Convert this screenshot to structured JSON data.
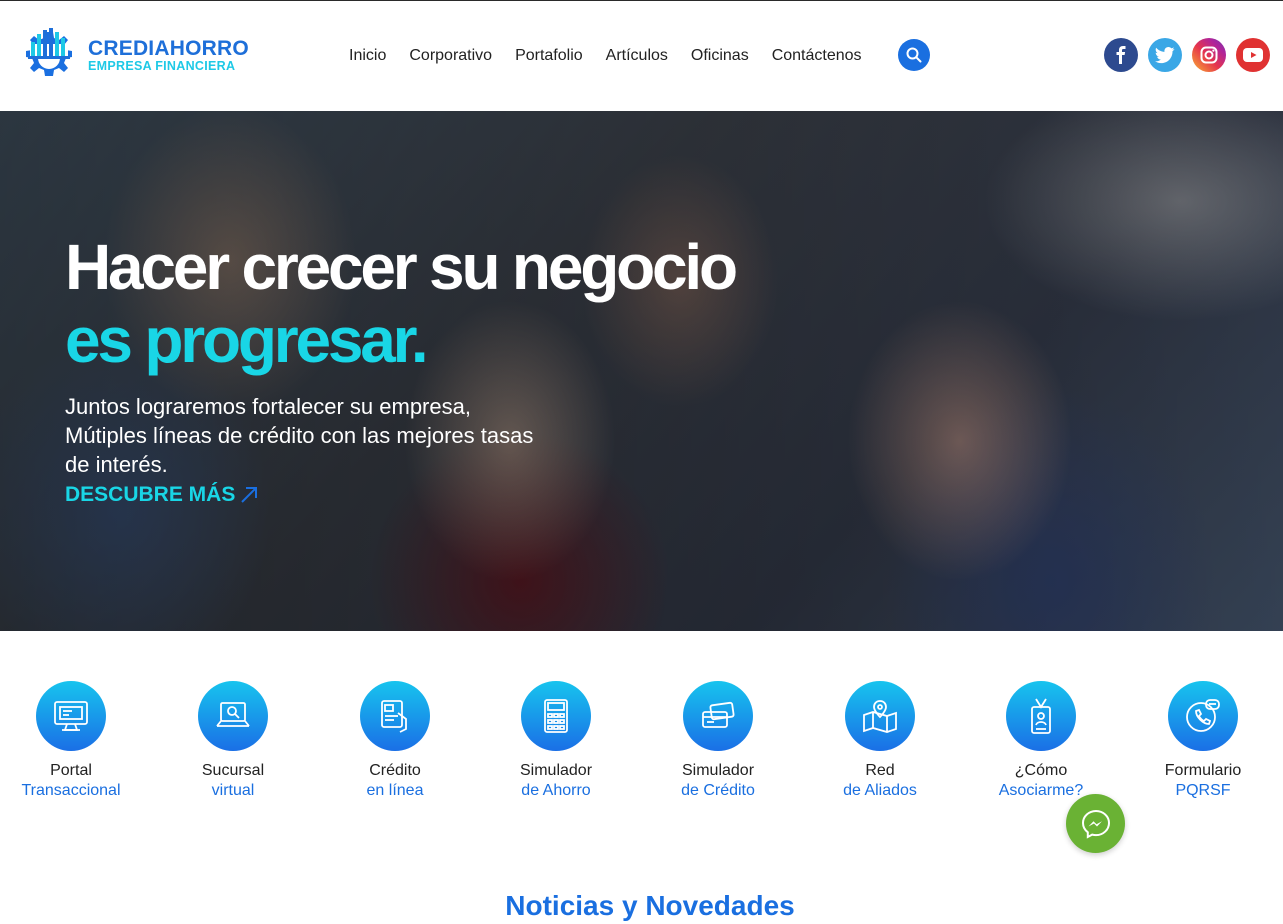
{
  "brand": {
    "name": "CREDIAHORRO",
    "tagline": "EMPRESA FINANCIERA",
    "colors": {
      "primary": "#1a6fe0",
      "accent": "#19d6e6"
    }
  },
  "nav": {
    "items": [
      "Inicio",
      "Corporativo",
      "Portafolio",
      "Artículos",
      "Oficinas",
      "Contáctenos"
    ]
  },
  "search": {
    "icon": "search-icon"
  },
  "social": [
    {
      "name": "facebook",
      "icon": "facebook-icon"
    },
    {
      "name": "twitter",
      "icon": "twitter-icon"
    },
    {
      "name": "instagram",
      "icon": "instagram-icon"
    },
    {
      "name": "youtube",
      "icon": "youtube-icon"
    }
  ],
  "hero": {
    "title_line1": "Hacer crecer su negocio",
    "title_line2": "es progresar.",
    "text": "Juntos lograremos fortalecer su empresa, Mútiples líneas de crédito con las mejores tasas de interés.",
    "cta": "DESCUBRE MÁS"
  },
  "services": [
    {
      "l1": "Portal",
      "l2": "Transaccional",
      "icon": "monitor-icon"
    },
    {
      "l1": "Sucursal",
      "l2": "virtual",
      "icon": "laptop-search-icon"
    },
    {
      "l1": "Crédito",
      "l2": "en línea",
      "icon": "hand-card-icon"
    },
    {
      "l1": "Simulador",
      "l2": "de Ahorro",
      "icon": "calculator-icon"
    },
    {
      "l1": "Simulador",
      "l2": "de Crédito",
      "icon": "cards-icon"
    },
    {
      "l1": "Red",
      "l2": "de Aliados",
      "icon": "map-pin-icon"
    },
    {
      "l1": "¿Cómo",
      "l2": "Asociarme?",
      "icon": "id-badge-icon"
    },
    {
      "l1": "Formulario",
      "l2": "PQRSF",
      "icon": "phone-chat-icon"
    }
  ],
  "chat": {
    "icon": "messenger-icon"
  },
  "news": {
    "title": "Noticias y Novedades"
  }
}
